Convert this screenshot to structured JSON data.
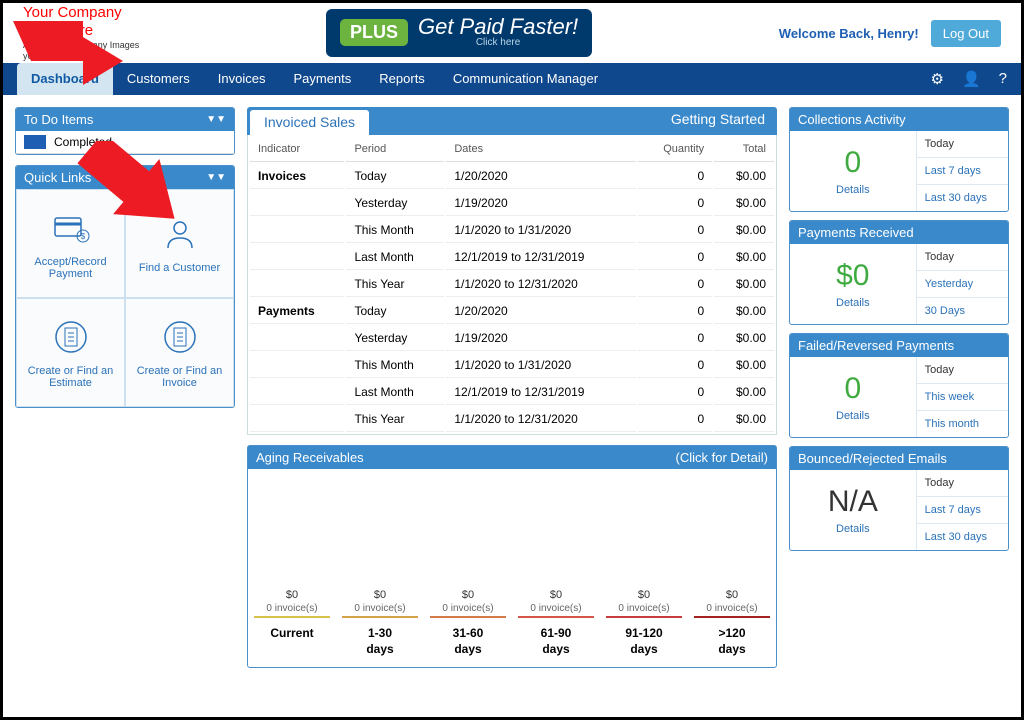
{
  "header": {
    "logo_line1": "Your Company",
    "logo_line2": "Logo Here",
    "logo_sub1": "Account -> Company Images",
    "logo_sub2": "your company logo.",
    "plus_badge": "PLUS",
    "plus_main": "Get Paid Faster!",
    "plus_sub": "Click here",
    "welcome": "Welcome Back, Henry!",
    "logout": "Log Out"
  },
  "nav": {
    "items": [
      "Dashboard",
      "Customers",
      "Invoices",
      "Payments",
      "Reports",
      "Communication Manager"
    ]
  },
  "todo": {
    "title": "To Do Items",
    "item": "Completed"
  },
  "quicklinks": {
    "title": "Quick Links",
    "cells": [
      "Accept/Record Payment",
      "Find a Customer",
      "Create or Find an Estimate",
      "Create or Find an Invoice"
    ]
  },
  "invoiced": {
    "tab": "Invoiced Sales",
    "right": "Getting Started",
    "headers": [
      "Indicator",
      "Period",
      "Dates",
      "Quantity",
      "Total"
    ],
    "rows": [
      {
        "ind": "Invoices",
        "period": "Today",
        "dates": "1/20/2020",
        "qty": "0",
        "total": "$0.00"
      },
      {
        "ind": "",
        "period": "Yesterday",
        "dates": "1/19/2020",
        "qty": "0",
        "total": "$0.00"
      },
      {
        "ind": "",
        "period": "This Month",
        "dates": "1/1/2020 to 1/31/2020",
        "qty": "0",
        "total": "$0.00"
      },
      {
        "ind": "",
        "period": "Last Month",
        "dates": "12/1/2019 to 12/31/2019",
        "qty": "0",
        "total": "$0.00"
      },
      {
        "ind": "",
        "period": "This Year",
        "dates": "1/1/2020 to 12/31/2020",
        "qty": "0",
        "total": "$0.00"
      },
      {
        "ind": "Payments",
        "period": "Today",
        "dates": "1/20/2020",
        "qty": "0",
        "total": "$0.00"
      },
      {
        "ind": "",
        "period": "Yesterday",
        "dates": "1/19/2020",
        "qty": "0",
        "total": "$0.00"
      },
      {
        "ind": "",
        "period": "This Month",
        "dates": "1/1/2020 to 1/31/2020",
        "qty": "0",
        "total": "$0.00"
      },
      {
        "ind": "",
        "period": "Last Month",
        "dates": "12/1/2019 to 12/31/2019",
        "qty": "0",
        "total": "$0.00"
      },
      {
        "ind": "",
        "period": "This Year",
        "dates": "1/1/2020 to 12/31/2020",
        "qty": "0",
        "total": "$0.00"
      }
    ]
  },
  "aging": {
    "title": "Aging Receivables",
    "right": "(Click for Detail)",
    "cols": [
      {
        "amt": "$0",
        "cnt": "0 invoice(s)",
        "label": "Current",
        "color": "#d4c24a"
      },
      {
        "amt": "$0",
        "cnt": "0 invoice(s)",
        "label": "1-30 days",
        "color": "#d4a24a"
      },
      {
        "amt": "$0",
        "cnt": "0 invoice(s)",
        "label": "31-60 days",
        "color": "#d47a4a"
      },
      {
        "amt": "$0",
        "cnt": "0 invoice(s)",
        "label": "61-90 days",
        "color": "#d4564a"
      },
      {
        "amt": "$0",
        "cnt": "0 invoice(s)",
        "label": "91-120 days",
        "color": "#c73c3c"
      },
      {
        "amt": "$0",
        "cnt": "0 invoice(s)",
        "label": ">120 days",
        "color": "#a52222"
      }
    ]
  },
  "stats": [
    {
      "title": "Collections Activity",
      "value": "0",
      "links": [
        "Today",
        "Last 7 days",
        "Last 30 days"
      ]
    },
    {
      "title": "Payments Received",
      "value": "$0",
      "links": [
        "Today",
        "Yesterday",
        "30 Days"
      ]
    },
    {
      "title": "Failed/Reversed Payments",
      "value": "0",
      "links": [
        "Today",
        "This week",
        "This month"
      ]
    },
    {
      "title": "Bounced/Rejected Emails",
      "value": "N/A",
      "value_color": "#333",
      "links": [
        "Today",
        "Last 7 days",
        "Last 30 days"
      ]
    }
  ],
  "details_label": "Details"
}
